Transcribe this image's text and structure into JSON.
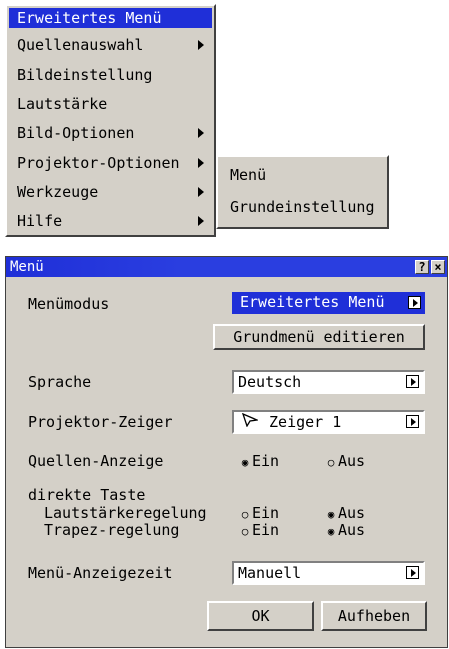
{
  "menu": {
    "title": "Erweitertes Menü",
    "items": [
      {
        "label": "Quellenauswahl",
        "submenu": true
      },
      {
        "label": "Bildeinstellung",
        "submenu": false
      },
      {
        "label": "Lautstärke",
        "submenu": false
      },
      {
        "label": "Bild-Optionen",
        "submenu": true
      },
      {
        "label": "Projektor-Optionen",
        "submenu": true
      },
      {
        "label": "Werkzeuge",
        "submenu": true
      },
      {
        "label": "Hilfe",
        "submenu": true
      }
    ]
  },
  "submenu": {
    "items": [
      "Menü",
      "Grundeinstellung"
    ]
  },
  "dialog": {
    "title": "Menü",
    "help_label": "?",
    "close_label": "×",
    "menu_mode_label": "Menümodus",
    "menu_mode_value": "Erweitertes Menü",
    "edit_basic_menu_button": "Grundmenü editieren",
    "language_label": "Sprache",
    "language_value": "Deutsch",
    "pointer_label": "Projektor-Zeiger",
    "pointer_value": "Zeiger 1",
    "source_display_label": "Quellen-Anzeige",
    "on_label": "Ein",
    "off_label": "Aus",
    "source_display_selected": "Ein",
    "direct_key_label": "direkte Taste",
    "volume_control_label": "Lautstärkeregelung",
    "volume_control_selected": "Aus",
    "keystone_label": "Trapez-regelung",
    "keystone_selected": "Aus",
    "menu_display_time_label": "Menü-Anzeigezeit",
    "menu_display_time_value": "Manuell",
    "ok_button": "OK",
    "cancel_button": "Aufheben"
  }
}
